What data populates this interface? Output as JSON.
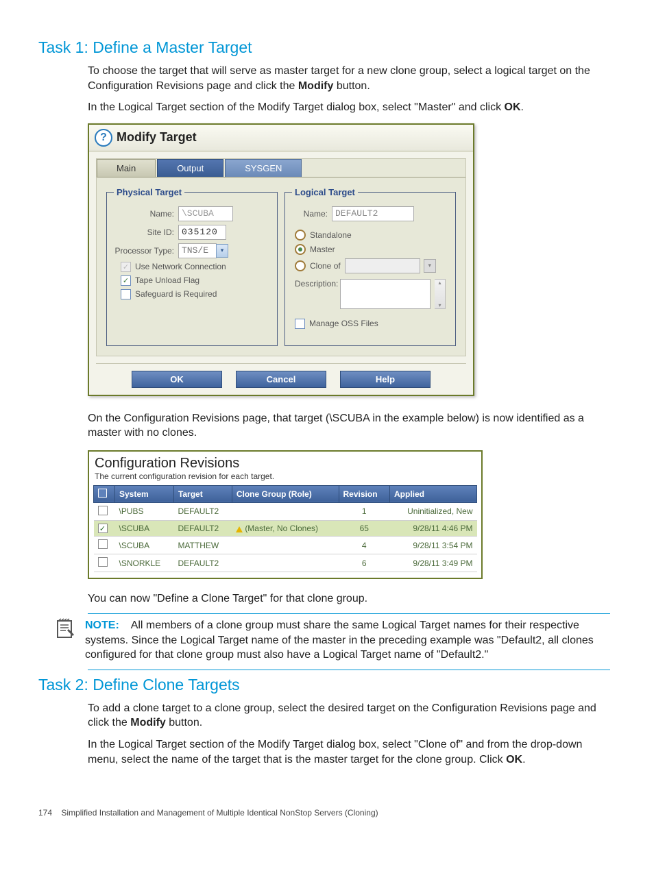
{
  "task1": {
    "heading": "Task 1: Define a Master Target",
    "p1_a": "To choose the target that will serve as master target for a new clone group, select a logical target on the Configuration Revisions page and click the ",
    "p1_b": "Modify",
    "p1_c": " button.",
    "p2_a": "In the Logical Target section of the Modify Target dialog box, select \"Master\" and click ",
    "p2_b": "OK",
    "p2_c": "."
  },
  "dialog": {
    "title": "Modify Target",
    "tabs": {
      "main": "Main",
      "output": "Output",
      "sysgen": "SYSGEN"
    },
    "physical": {
      "legend": "Physical Target",
      "name_label": "Name:",
      "name_value": "\\SCUBA",
      "siteid_label": "Site ID:",
      "siteid_value": "035120",
      "proc_label": "Processor Type:",
      "proc_value": "TNS/E",
      "use_network": "Use Network Connection",
      "tape_unload": "Tape Unload Flag",
      "safeguard": "Safeguard is Required"
    },
    "logical": {
      "legend": "Logical Target",
      "name_label": "Name:",
      "name_value": "DEFAULT2",
      "standalone": "Standalone",
      "master": "Master",
      "cloneof": "Clone of",
      "description": "Description:",
      "manage_oss": "Manage OSS Files"
    },
    "buttons": {
      "ok": "OK",
      "cancel": "Cancel",
      "help": "Help"
    }
  },
  "mid_p": "On the Configuration Revisions page, that target (\\SCUBA in the example below) is now identified as a master with no clones.",
  "revs": {
    "title": "Configuration Revisions",
    "sub": "The current configuration revision for each target.",
    "headers": {
      "system": "System",
      "target": "Target",
      "clone": "Clone Group (Role)",
      "rev": "Revision",
      "applied": "Applied"
    },
    "rows": [
      {
        "checked": false,
        "system": "\\PUBS",
        "target": "DEFAULT2",
        "clone": "",
        "rev": "1",
        "applied": "Uninitialized, New"
      },
      {
        "checked": true,
        "system": "\\SCUBA",
        "target": "DEFAULT2",
        "clone": "(Master, No Clones)",
        "rev": "65",
        "applied": "9/28/11 4:46 PM",
        "warn": true,
        "sel": true
      },
      {
        "checked": false,
        "system": "\\SCUBA",
        "target": "MATTHEW",
        "clone": "",
        "rev": "4",
        "applied": "9/28/11 3:54 PM"
      },
      {
        "checked": false,
        "system": "\\SNORKLE",
        "target": "DEFAULT2",
        "clone": "",
        "rev": "6",
        "applied": "9/28/11 3:49 PM"
      }
    ]
  },
  "after_revs": "You can now \"Define a Clone Target\" for that clone group.",
  "note": {
    "label": "NOTE:",
    "text": "All members of a clone group must share the same Logical Target names for their respective systems. Since the Logical Target name of the master in the preceding example was \"Default2, all clones configured for that clone group must also have a Logical Target name of \"Default2.\""
  },
  "task2": {
    "heading": "Task 2: Define Clone Targets",
    "p1_a": "To add a clone target to a clone group, select the desired target on the Configuration Revisions page and click the ",
    "p1_b": "Modify",
    "p1_c": " button.",
    "p2_a": "In the Logical Target section of the Modify Target dialog box, select \"Clone of\" and from the drop-down menu, select the name of the target that is the master target for the clone group. Click ",
    "p2_b": "OK",
    "p2_c": "."
  },
  "footer": {
    "page": "174",
    "chapter": "Simplified Installation and Management of Multiple Identical NonStop Servers (Cloning)"
  }
}
